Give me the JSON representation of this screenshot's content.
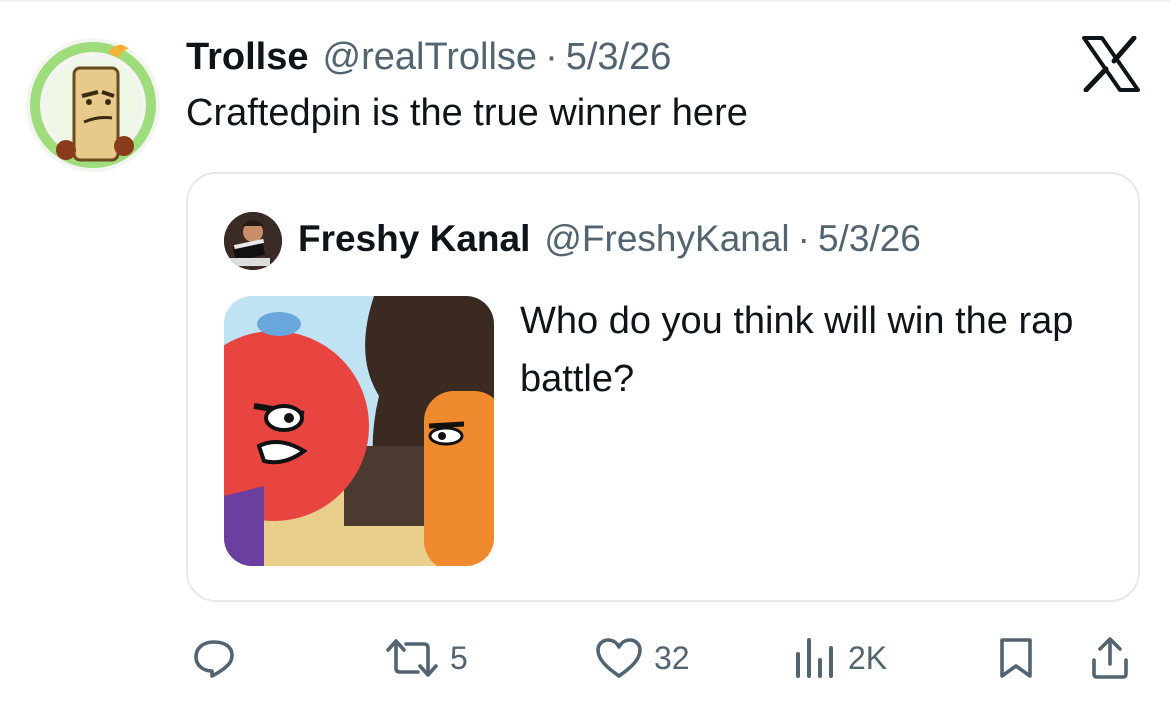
{
  "post": {
    "author_name": "Trollse",
    "author_handle": "@realTrollse",
    "separator": "·",
    "date": "5/3/26",
    "text": "Craftedpin is the true winner here",
    "avatar_icon": "candle-character-avatar"
  },
  "quoted": {
    "author_name": "Freshy Kanal",
    "author_handle": "@FreshyKanal",
    "separator": "·",
    "date": "5/3/26",
    "text": "Who do you think will win the rap battle?",
    "avatar_icon": "freshy-kanal-avatar",
    "media_icon": "cartoon-characters-thumbnail"
  },
  "actions": {
    "reply": {
      "icon": "reply-icon",
      "count": ""
    },
    "repost": {
      "icon": "repost-icon",
      "count": "5"
    },
    "like": {
      "icon": "heart-icon",
      "count": "32"
    },
    "views": {
      "icon": "views-icon",
      "count": "2K"
    },
    "bookmark": {
      "icon": "bookmark-icon"
    },
    "share": {
      "icon": "share-icon"
    }
  },
  "brand": {
    "logo": "x-logo",
    "text_color": "#0f1419",
    "muted_color": "#536471",
    "border_color": "#e6e9ec"
  }
}
